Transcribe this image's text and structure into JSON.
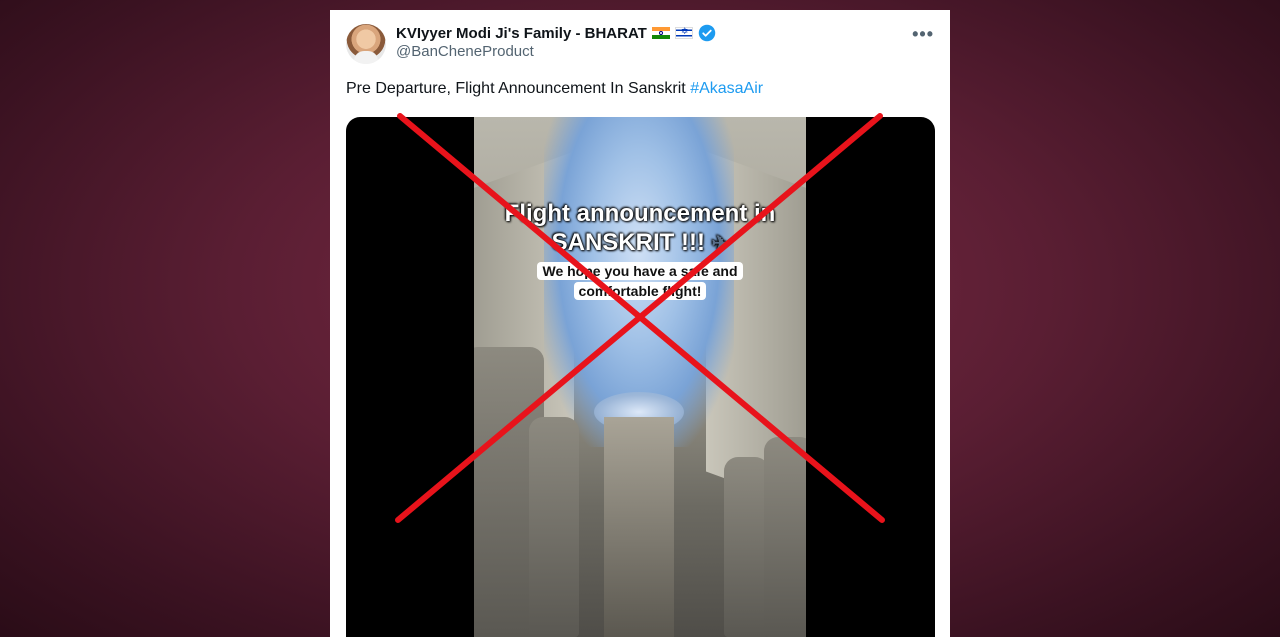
{
  "tweet": {
    "display_name": "KVIyyer Modi Ji's Family - BHARAT",
    "flags": [
      "india-flag-icon",
      "israel-flag-icon"
    ],
    "verified_icon": "verified-badge-icon",
    "handle": "@BanCheneProduct",
    "more_label": "•••",
    "text": "Pre Departure, Flight Announcement In Sanskrit ",
    "hashtag": "#AkasaAir"
  },
  "video": {
    "overlay_title_line1": "Flight announcement in",
    "overlay_title_line2": "SANSKRIT !!! ",
    "overlay_title_icon": "✈",
    "overlay_subtitle_line1": "We hope you have a safe and",
    "overlay_subtitle_line2": "comfortable flight!"
  },
  "overlay_mark": {
    "type": "red-x-cross-icon",
    "color": "#e8131b"
  },
  "colors": {
    "link": "#1d9bf0",
    "verified": "#1d9bf0",
    "background": "#5a1e33"
  }
}
